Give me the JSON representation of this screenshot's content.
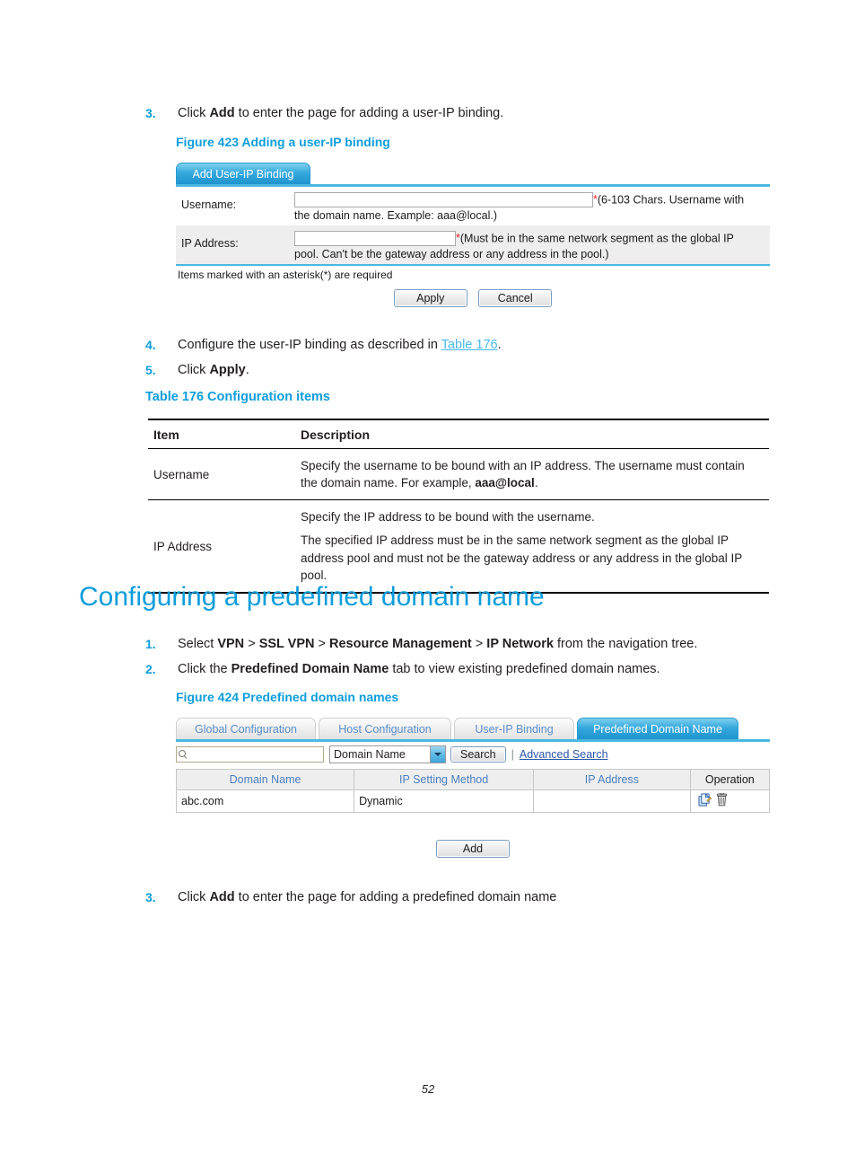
{
  "doc": {
    "page_number": "52"
  },
  "steps_top": [
    {
      "num": "3.",
      "pre": "Click ",
      "bold": "Add",
      "post": " to enter the page for adding a user-IP binding."
    }
  ],
  "figure423": {
    "caption": "Figure 423 Adding a user-IP binding",
    "tabs": [
      {
        "label": "Add User-IP Binding",
        "active": true
      }
    ],
    "fields": [
      {
        "label": "Username:",
        "value": "",
        "required_mark": "*",
        "hint_inline": "(6-103 Chars. Username with",
        "hint_wrap": "the domain name. Example: aaa@local.)"
      },
      {
        "label": "IP Address:",
        "value": "",
        "required_mark": "*",
        "hint_inline": "(Must be in the same network segment as the global IP",
        "hint_wrap": "pool. Can't be the gateway address or any address in the pool.)"
      }
    ],
    "note": "Items marked with an asterisk(*) are required",
    "buttons": [
      {
        "label": "Apply"
      },
      {
        "label": "Cancel"
      }
    ]
  },
  "steps_mid": [
    {
      "num": "4.",
      "pre": "Configure the user-IP binding as described in ",
      "link": "Table 176",
      "post": "."
    },
    {
      "num": "5.",
      "pre": "Click ",
      "bold": "Apply",
      "post": "."
    }
  ],
  "table176": {
    "caption": "Table 176 Configuration items",
    "headers": [
      "Item",
      "Description"
    ],
    "rows": [
      {
        "item": "Username",
        "description_parts": [
          {
            "text": "Specify the username to be bound with an IP address. The username must contain the domain name. For example, "
          },
          {
            "text": "aaa@local",
            "bold": true
          },
          {
            "text": "."
          }
        ]
      },
      {
        "item": "IP Address",
        "paragraphs": [
          "Specify the IP address to be bound with the username.",
          "The specified IP address must be in the same network segment as the global IP address pool and must not be the gateway address or any address in the global IP pool."
        ]
      }
    ]
  },
  "section": {
    "title": "Configuring a predefined domain name"
  },
  "steps_section": [
    {
      "num": "1.",
      "segments": [
        {
          "text": "Select "
        },
        {
          "text": "VPN",
          "bold": true
        },
        {
          "text": " > "
        },
        {
          "text": "SSL VPN",
          "bold": true
        },
        {
          "text": " > "
        },
        {
          "text": "Resource Management",
          "bold": true
        },
        {
          "text": " > "
        },
        {
          "text": "IP Network",
          "bold": true
        },
        {
          "text": " from the navigation tree."
        }
      ]
    },
    {
      "num": "2.",
      "segments": [
        {
          "text": "Click the "
        },
        {
          "text": "Predefined Domain Name",
          "bold": true
        },
        {
          "text": " tab to view existing predefined domain names."
        }
      ]
    }
  ],
  "figure424": {
    "caption": "Figure 424 Predefined domain names",
    "tabs": [
      {
        "label": "Global Configuration",
        "active": false
      },
      {
        "label": "Host Configuration",
        "active": false
      },
      {
        "label": "User-IP Binding",
        "active": false
      },
      {
        "label": "Predefined Domain Name",
        "active": true
      }
    ],
    "search": {
      "input_value": "",
      "input_placeholder": "",
      "icon": "search-icon",
      "select_value": "Domain Name",
      "select_options": [
        "Domain Name"
      ],
      "search_button": "Search",
      "divider": "|",
      "advanced_link": "Advanced Search"
    },
    "table": {
      "headers": [
        "Domain Name",
        "IP Setting Method",
        "IP Address",
        "Operation"
      ],
      "rows": [
        {
          "domain_name": "abc.com",
          "ip_setting_method": "Dynamic",
          "ip_address": "",
          "operations": [
            "edit-icon",
            "delete-icon"
          ]
        }
      ]
    },
    "add_button": "Add"
  },
  "steps_bottom": [
    {
      "num": "3.",
      "pre": "Click ",
      "bold": "Add",
      "post": " to enter the page for adding a predefined domain name"
    }
  ],
  "colors": {
    "accent_blue": "#0d9ddb",
    "link_blue": "#4ab9e8",
    "tab_active": "#2a9bd0",
    "required_red": "#e8252a",
    "ui_link": "#2b55a8"
  }
}
